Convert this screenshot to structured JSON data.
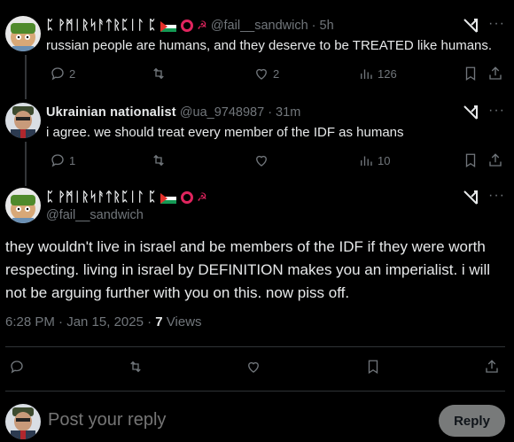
{
  "tweets": [
    {
      "name": "ᛈ ᚹᛗᛁᚱᛋᚨᛏᚱᛈᛁᛚ ᛈ",
      "handle": "@fail__sandwich",
      "time": "· 5h",
      "text": "russian people are humans, and they deserve to be TREATED like humans.",
      "replies": "2",
      "retweets": "",
      "likes": "2",
      "views": "126"
    },
    {
      "name": "Ukrainian nationalist",
      "handle": "@ua_9748987",
      "time": "· 31m",
      "text": "i agree. we should treat every member of the IDF as humans",
      "replies": "1",
      "retweets": "",
      "likes": "",
      "views": "10"
    }
  ],
  "main": {
    "name": "ᛈ ᚹᛗᛁᚱᛋᚨᛏᚱᛈᛁᛚ ᛈ",
    "handle": "@fail__sandwich",
    "text": "they wouldn't live in israel and be members of the IDF if they were worth respecting. living in israel by DEFINITION makes you an imperialist. i will not be arguing further with you on this. now piss off.",
    "timestamp": "6:28 PM · Jan 15, 2025 ·",
    "views_count": "7",
    "views_label": "Views"
  },
  "reply": {
    "placeholder": "Post your reply",
    "button_label": "Reply"
  },
  "more_icon": "···",
  "sickle_icon": "☭",
  "colors": {
    "accent_red": "#e0245e",
    "muted": "#71767b",
    "text": "#e7e9ea",
    "bg": "#000000"
  }
}
